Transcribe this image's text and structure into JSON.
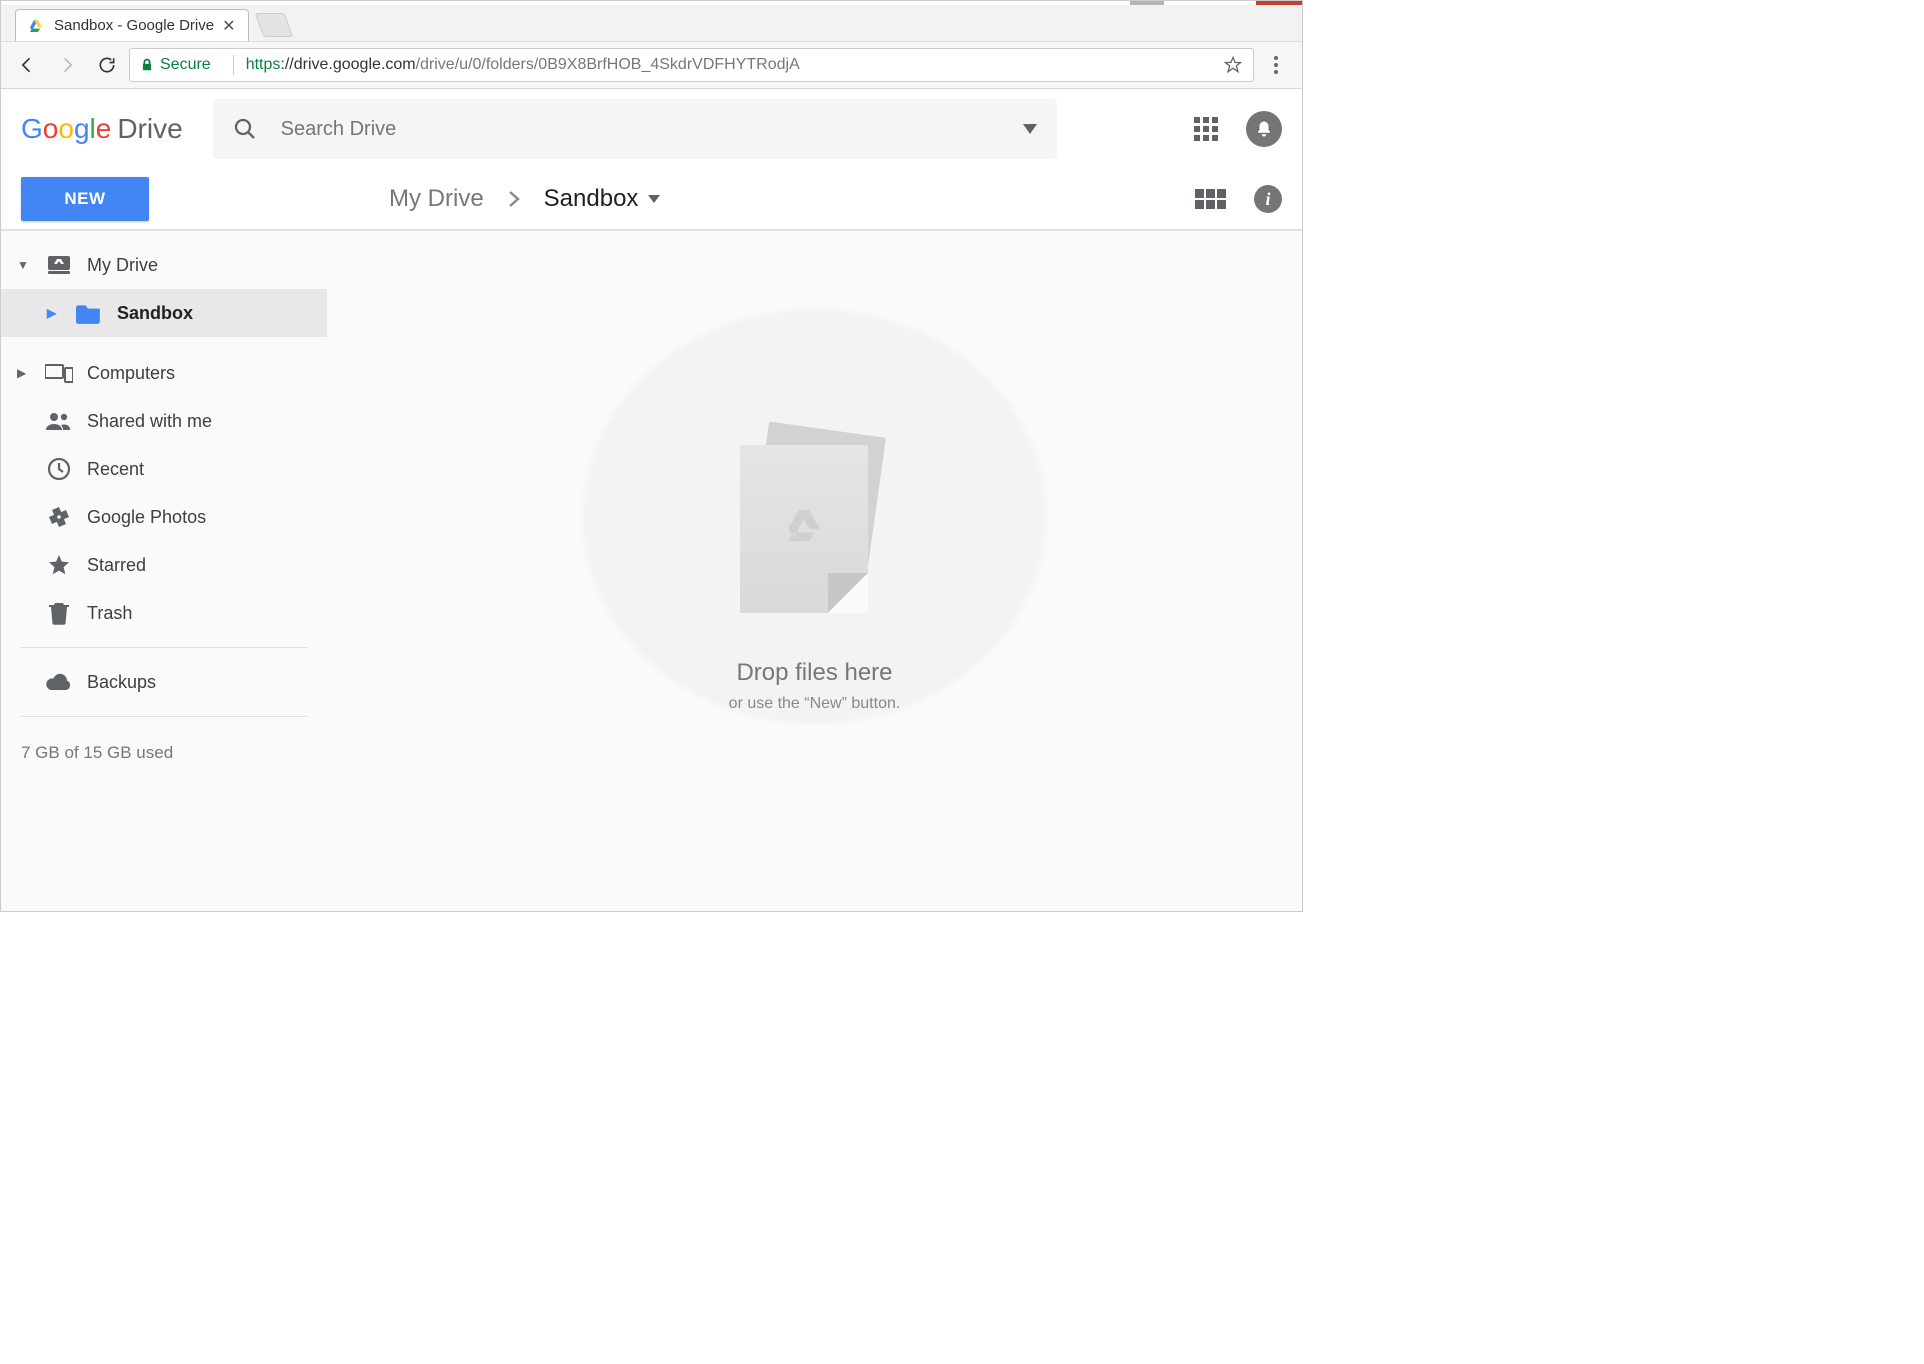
{
  "window": {
    "tab_title": "Sandbox - Google Drive"
  },
  "addressbar": {
    "secure_label": "Secure",
    "url_scheme": "https",
    "url_host": "://drive.google.com",
    "url_path": "/drive/u/0/folders/0B9X8BrfHOB_4SkdrVDFHYTRodjA"
  },
  "drive": {
    "logo_product": "Drive",
    "search_placeholder": "Search Drive",
    "new_button": "NEW"
  },
  "breadcrumb": {
    "root": "My Drive",
    "current": "Sandbox"
  },
  "sidebar": {
    "my_drive": "My Drive",
    "sandbox": "Sandbox",
    "computers": "Computers",
    "shared": "Shared with me",
    "recent": "Recent",
    "photos": "Google Photos",
    "starred": "Starred",
    "trash": "Trash",
    "backups": "Backups"
  },
  "storage": {
    "text": "7 GB of 15 GB used"
  },
  "empty": {
    "title": "Drop files here",
    "subtitle": "or use the “New” button."
  }
}
